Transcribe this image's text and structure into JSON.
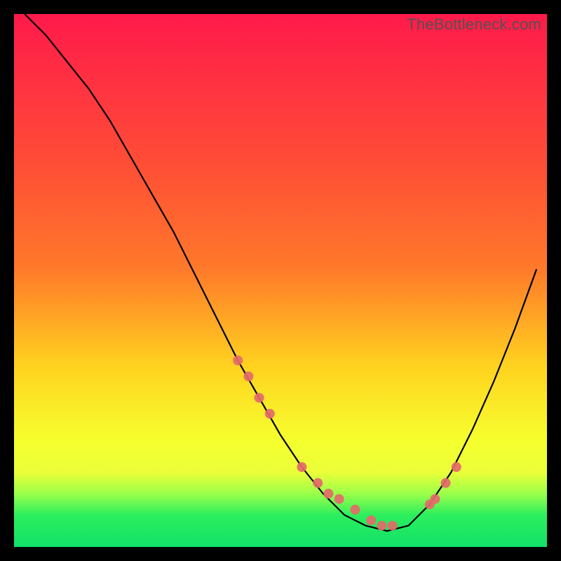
{
  "watermark": "TheBottleneck.com",
  "chart_data": {
    "type": "line",
    "title": "",
    "xlabel": "",
    "ylabel": "",
    "xlim": [
      0,
      100
    ],
    "ylim": [
      0,
      100
    ],
    "grid": false,
    "legend": false,
    "background_gradient": {
      "top": "#ff1a4b",
      "mid1": "#ff7a2a",
      "mid2": "#ffd21f",
      "mid3": "#f6ff2e",
      "bottom_band": "#9bff4a",
      "bottom": "#11e06a"
    },
    "series": [
      {
        "name": "curve",
        "color": "#000000",
        "x": [
          2,
          6,
          10,
          14,
          18,
          22,
          26,
          30,
          34,
          38,
          42,
          46,
          50,
          54,
          58,
          62,
          66,
          70,
          74,
          78,
          82,
          86,
          90,
          94,
          98
        ],
        "y": [
          100,
          96,
          91,
          86,
          80,
          73,
          66,
          59,
          51,
          43,
          35,
          28,
          21,
          15,
          10,
          6,
          4,
          3,
          4,
          8,
          14,
          22,
          31,
          41,
          52
        ]
      },
      {
        "name": "markers",
        "color": "#e46a6a",
        "type": "scatter",
        "x": [
          42,
          44,
          46,
          48,
          54,
          57,
          59,
          61,
          64,
          67,
          69,
          71,
          78,
          79,
          81,
          83
        ],
        "y": [
          35,
          32,
          28,
          25,
          15,
          12,
          10,
          9,
          7,
          5,
          4,
          4,
          8,
          9,
          12,
          15
        ]
      }
    ]
  }
}
